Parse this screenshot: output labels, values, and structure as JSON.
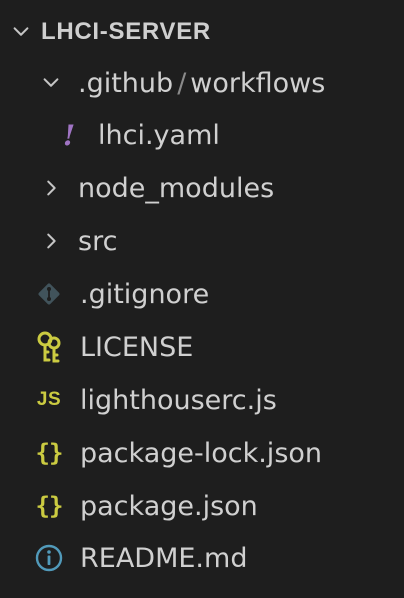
{
  "explorer": {
    "root": {
      "label": "LHCI-SERVER",
      "expanded": true
    },
    "items": [
      {
        "type": "folder",
        "expanded": true,
        "path_parts": [
          ".github",
          "workflows"
        ],
        "separator": "/"
      },
      {
        "type": "file",
        "label": "lhci.yaml",
        "icon": "yaml-icon",
        "icon_glyph": "!",
        "icon_color": "#a074c4"
      },
      {
        "type": "folder",
        "expanded": false,
        "label": "node_modules"
      },
      {
        "type": "folder",
        "expanded": false,
        "label": "src"
      },
      {
        "type": "file",
        "label": ".gitignore",
        "icon": "git-icon",
        "icon_color": "#41535b"
      },
      {
        "type": "file",
        "label": "LICENSE",
        "icon": "license-key-icon",
        "icon_color": "#cbcb41"
      },
      {
        "type": "file",
        "label": "lighthouserc.js",
        "icon": "js-icon",
        "icon_glyph": "JS",
        "icon_color": "#cbcb41"
      },
      {
        "type": "file",
        "label": "package-lock.json",
        "icon": "json-icon",
        "icon_glyph": "{}",
        "icon_color": "#cbcb41"
      },
      {
        "type": "file",
        "label": "package.json",
        "icon": "json-icon",
        "icon_glyph": "{}",
        "icon_color": "#cbcb41"
      },
      {
        "type": "file",
        "label": "README.md",
        "icon": "info-icon",
        "icon_color": "#519aba"
      }
    ]
  }
}
